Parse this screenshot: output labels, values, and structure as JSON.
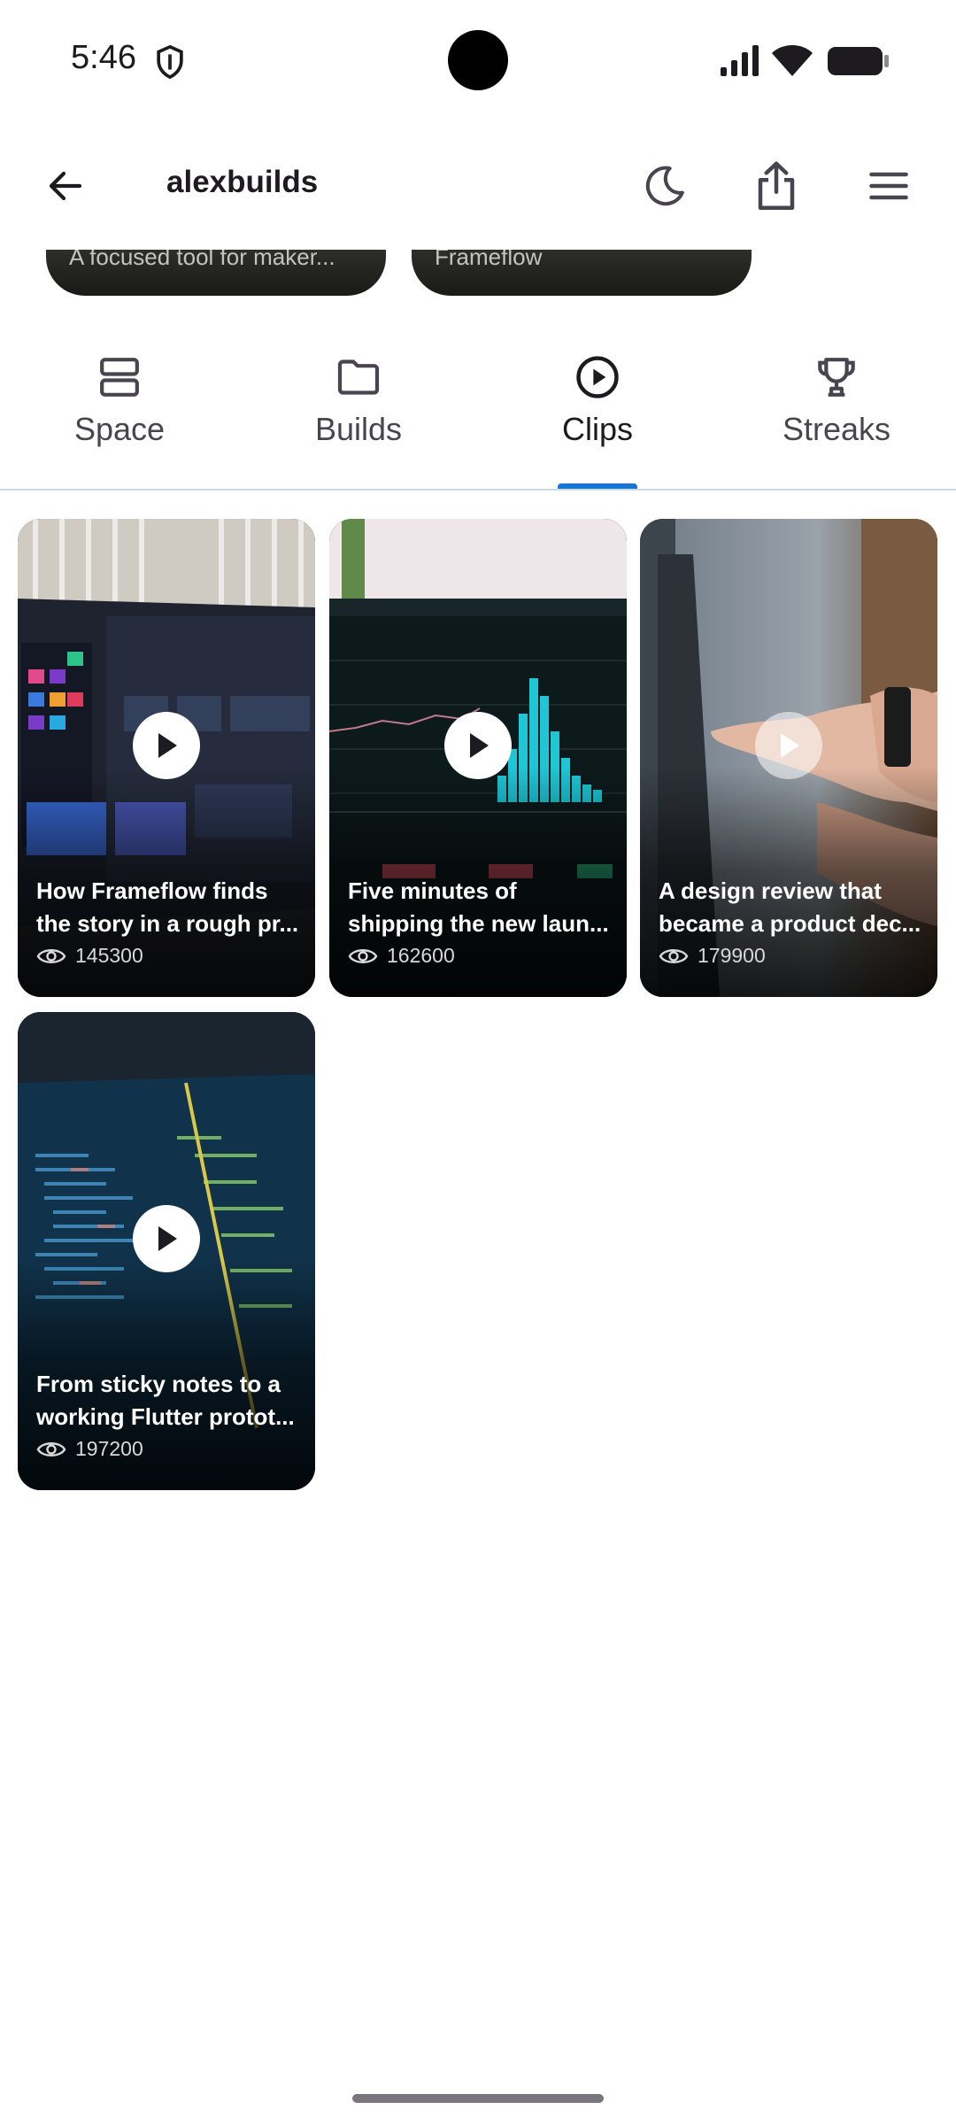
{
  "status_bar": {
    "time": "5:46",
    "icons": [
      "shield-icon",
      "signal-icon",
      "wifi-icon",
      "battery-icon"
    ]
  },
  "app_bar": {
    "title": "alexbuilds",
    "icons": [
      "back-arrow-icon",
      "dark-mode-moon-icon",
      "share-icon",
      "menu-icon"
    ]
  },
  "header_cards": [
    {
      "text": "A focused tool for maker..."
    },
    {
      "text": "Frameflow"
    }
  ],
  "tabs": [
    {
      "label": "Space",
      "icon": "space-layout-icon",
      "active": false
    },
    {
      "label": "Builds",
      "icon": "folder-icon",
      "active": false
    },
    {
      "label": "Clips",
      "icon": "play-circle-icon",
      "active": true
    },
    {
      "label": "Streaks",
      "icon": "trophy-icon",
      "active": false
    }
  ],
  "clips": [
    {
      "title_line1": "How Frameflow finds",
      "title_line2": "the story in a rough pr...",
      "views": "145300"
    },
    {
      "title_line1": "Five minutes of",
      "title_line2": "shipping the new laun...",
      "views": "162600"
    },
    {
      "title_line1": "A design review that",
      "title_line2": "became a product dec...",
      "views": "179900"
    },
    {
      "title_line1": "From sticky notes to a",
      "title_line2": "working Flutter protot...",
      "views": "197200"
    }
  ],
  "colors": {
    "accent": "#1976d2",
    "text_primary": "#1d1b20",
    "text_secondary": "#49454f",
    "divider": "#c9dcec"
  }
}
